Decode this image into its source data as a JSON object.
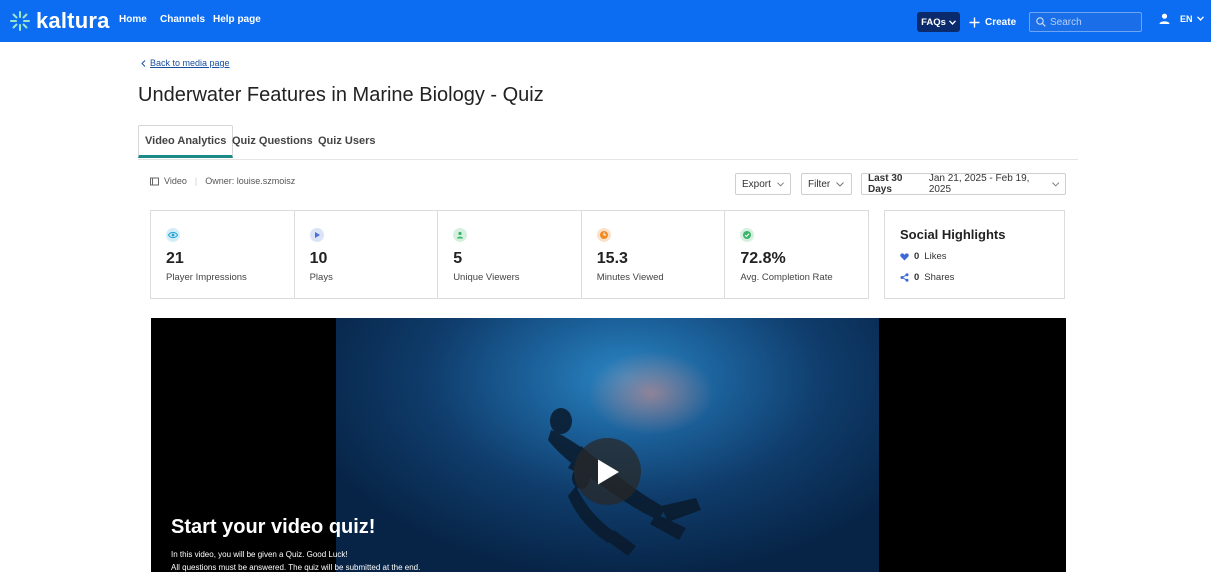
{
  "header": {
    "logo_text": "kaltura",
    "nav": [
      "Home",
      "Channels",
      "Help page"
    ],
    "faqs_label": "FAQs",
    "create_label": "Create",
    "search_placeholder": "Search",
    "language": "EN",
    "brand_color": "#0c6cf2"
  },
  "page": {
    "back_link": "Back to media page",
    "title": "Underwater Features in Marine Biology - Quiz",
    "tabs": [
      "Video Analytics",
      "Quiz Questions",
      "Quiz Users"
    ],
    "active_tab": "Video Analytics"
  },
  "meta": {
    "type_label": "Video",
    "owner": "Owner: louise.szmoisz"
  },
  "controls": {
    "export_label": "Export",
    "filter_label": "Filter",
    "date_preset": "Last 30 Days",
    "date_range": "Jan 21, 2025 - Feb 19, 2025"
  },
  "stats": [
    {
      "value": "21",
      "label": "Player Impressions",
      "icon": "eye-icon",
      "color": "#2aa3d6"
    },
    {
      "value": "10",
      "label": "Plays",
      "icon": "play-icon",
      "color": "#4a6fd9"
    },
    {
      "value": "5",
      "label": "Unique Viewers",
      "icon": "user-icon",
      "color": "#3bb56a"
    },
    {
      "value": "15.3",
      "label": "Minutes Viewed",
      "icon": "clock-icon",
      "color": "#f08a24"
    },
    {
      "value": "72.8%",
      "label": "Avg. Completion Rate",
      "icon": "check-icon",
      "color": "#3bb56a"
    }
  ],
  "social": {
    "title": "Social Highlights",
    "likes_count": "0",
    "likes_label": "Likes",
    "shares_count": "0",
    "shares_label": "Shares",
    "accent": "#3d6ad6"
  },
  "player": {
    "quiz_title": "Start your video quiz!",
    "line1": "In this video, you will be given a Quiz. Good Luck!",
    "line2": "All questions must be answered. The quiz will be submitted at the end."
  }
}
